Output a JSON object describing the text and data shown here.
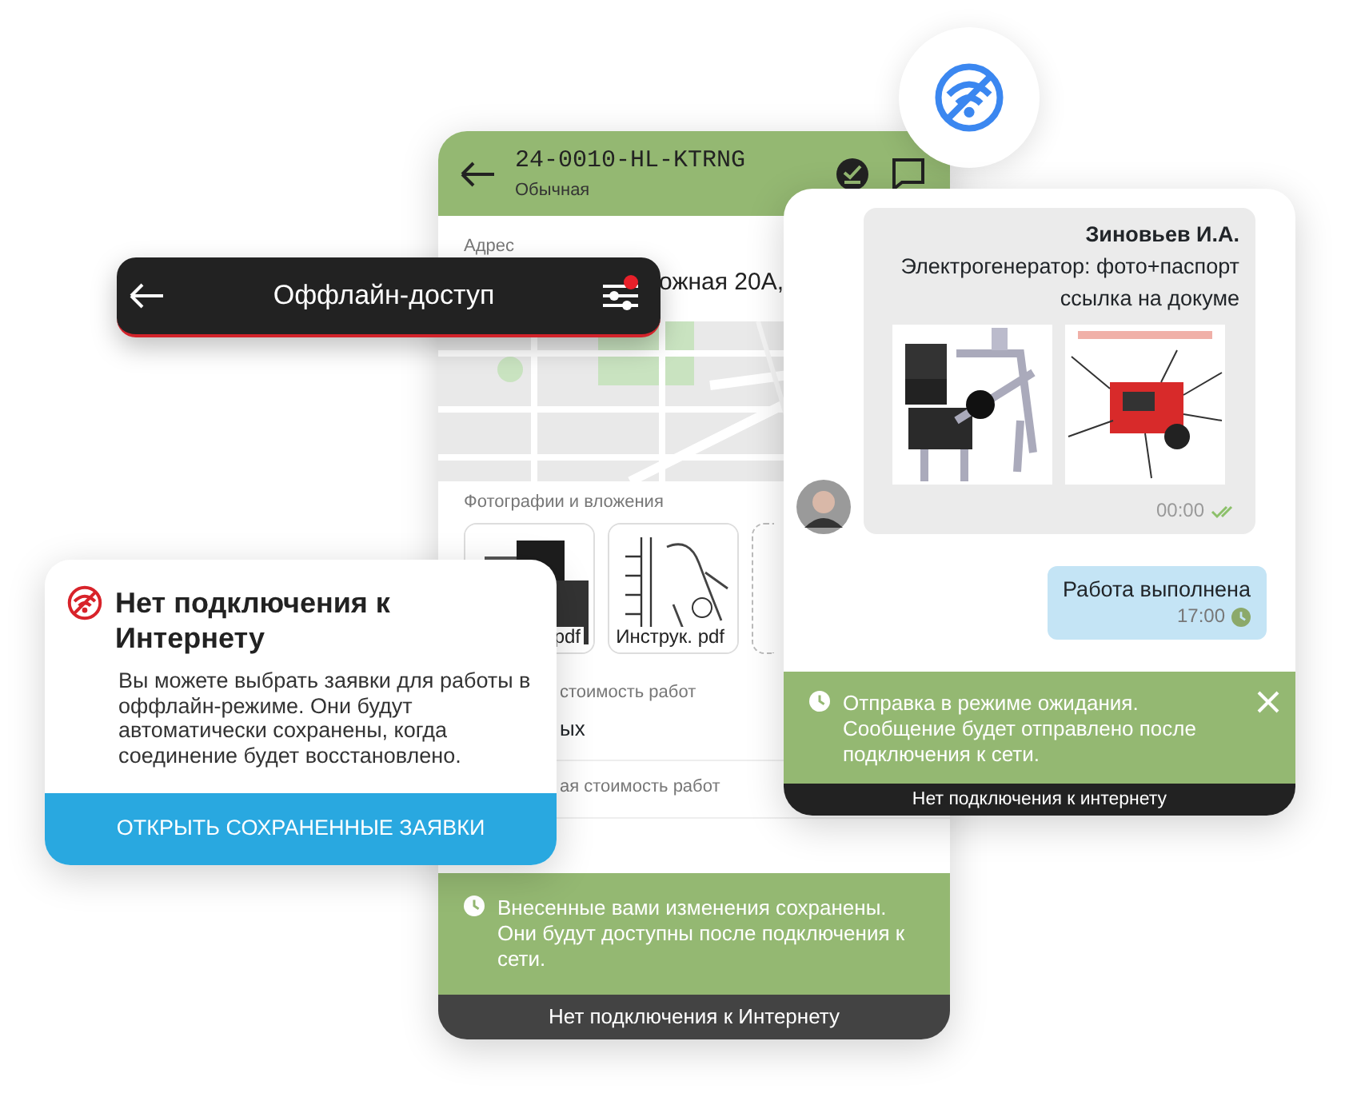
{
  "order_screen": {
    "header": {
      "title": "24-0010-HL-KTRNG",
      "subtitle": "Обычная"
    },
    "address": {
      "label": "Адрес",
      "value": "ожная 20А,"
    },
    "map": {
      "kind": "picture"
    },
    "attachments": {
      "label": "Фотографии и вложения",
      "items": [
        {
          "kind": "file",
          "name": "pdf"
        },
        {
          "kind": "file",
          "name": "Инструк. pdf"
        },
        {
          "kind": "add"
        }
      ]
    },
    "fields": [
      {
        "label": "стоимость работ",
        "value": "ых"
      },
      {
        "label": "ая стоимость работ"
      }
    ],
    "toast": {
      "text": "Внесенные вами изменения сохранены. Они будут доступны после подключения к сети."
    },
    "status_bar": "Нет подключения к Интернету"
  },
  "offline_bar": {
    "title": "Оффлайн-доступ",
    "filter_badge": true
  },
  "dialog": {
    "title": "Нет подключения к Интернету",
    "text": "Вы можете выбрать заявки для работы в оффлайн-режиме. Они будут автоматически сохранены, когда соединение будет восстановлено.",
    "button": "ОТКРЫТЬ СОХРАНЕННЫЕ ЗАЯВКИ"
  },
  "chat": {
    "messages": [
      {
        "kind": "incoming",
        "author": "Зиновьев И.А.",
        "lines": [
          "Электрогенератор: фото+паспорт",
          "ссылка на докуме"
        ],
        "images": [
          {
            "kind": "picture"
          },
          {
            "kind": "picture"
          }
        ],
        "time": "00:00",
        "read": true
      },
      {
        "kind": "outgoing",
        "text": "Работа выполнена",
        "time": "17:00",
        "read": false
      }
    ],
    "toast": {
      "text": "Отправка в режиме ожидания. Сообщение будет отправлено после подключения к сети."
    },
    "status_bar": "Нет подключения к интернету"
  }
}
